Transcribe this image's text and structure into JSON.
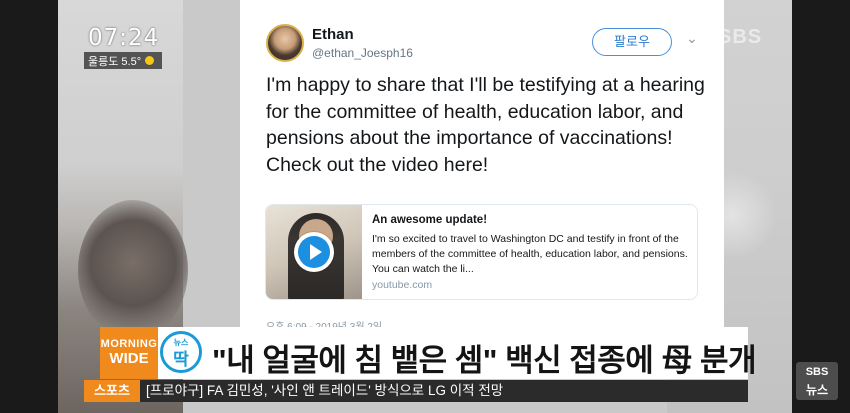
{
  "broadcast": {
    "clock": "07:24",
    "weather": "울릉도 5.5°",
    "channel_mark": "SBS",
    "program_logo_top": "MORNING",
    "program_logo_bottom": "WIDE",
    "badge_small": "뉴스",
    "badge_big": "딱",
    "headline": "\"내 얼굴에 침 뱉은 셈\" 백신 접종에 母 분개",
    "ticker_tag": "스포츠",
    "ticker_text": "[프로야구] FA 김민성, '사인 앤 트레이드' 방식으로 LG 이적 전망",
    "sbs_news_top": "SBS",
    "sbs_news_bottom": "뉴스"
  },
  "tweet": {
    "name": "Ethan",
    "handle": "@ethan_Joesph16",
    "follow_label": "팔로우",
    "text": "I'm happy to share that I'll be testifying at a hearing for the committee of health, education labor, and pensions about the importance of vaccinations! Check out the video here!",
    "card": {
      "title": "An awesome update!",
      "description": "I'm so excited to travel to Washington DC and testify in front of the members of the committee of health, education labor, and pensions. You can watch the li...",
      "domain": "youtube.com"
    },
    "timestamp": "오후 6:09 - 2019년 3월 2일"
  },
  "colors": {
    "orange_brand": "#f08a1c",
    "badge_blue": "#1a9bd7",
    "follow_blue": "#2c7cd1",
    "play_blue": "#1d8fe0"
  }
}
